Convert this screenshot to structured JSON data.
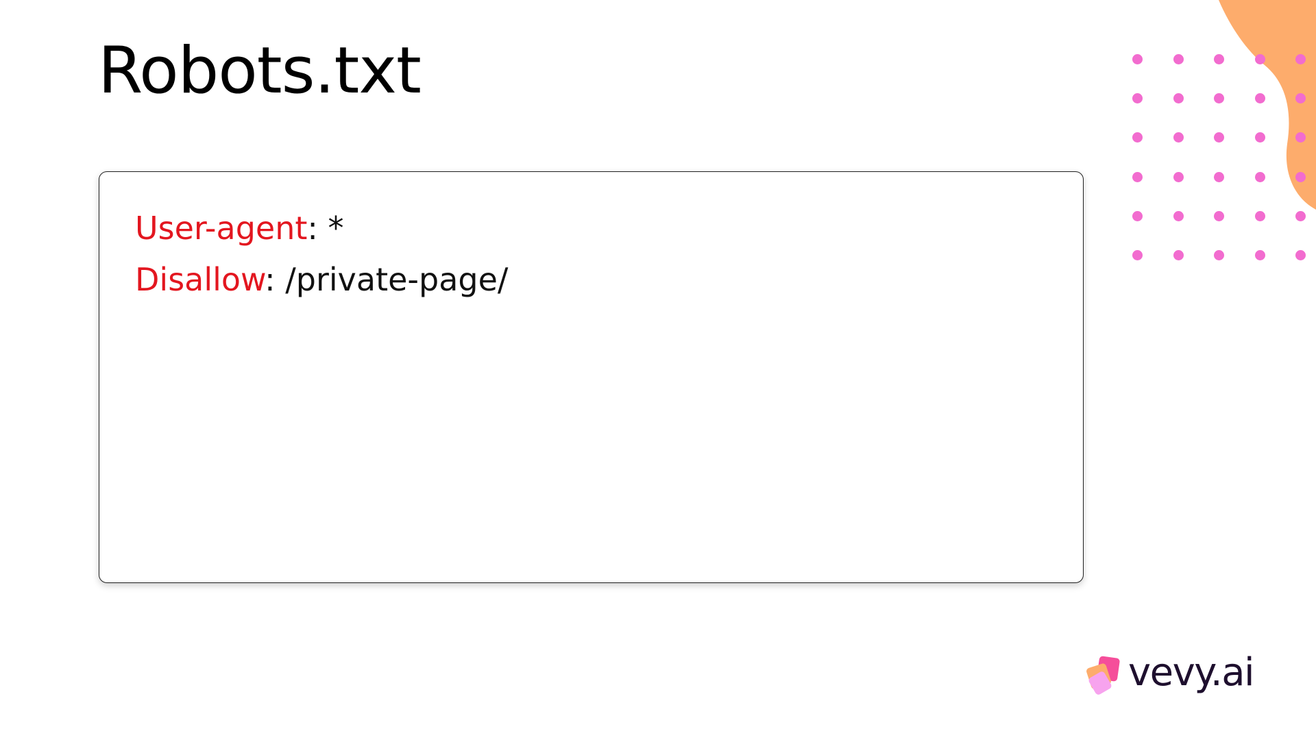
{
  "slide": {
    "title": "Robots.txt"
  },
  "code": {
    "lines": [
      {
        "key": "User-agent",
        "separator": ":",
        "value": "*"
      },
      {
        "key": "Disallow",
        "separator": ":",
        "value": "/private-page/"
      }
    ]
  },
  "brand": {
    "name": "vevy.ai"
  },
  "colors": {
    "keyword": "#e3161f",
    "dots": "#f26ccf",
    "blob": "#fdac6c",
    "brand_text": "#1e0f2e"
  }
}
